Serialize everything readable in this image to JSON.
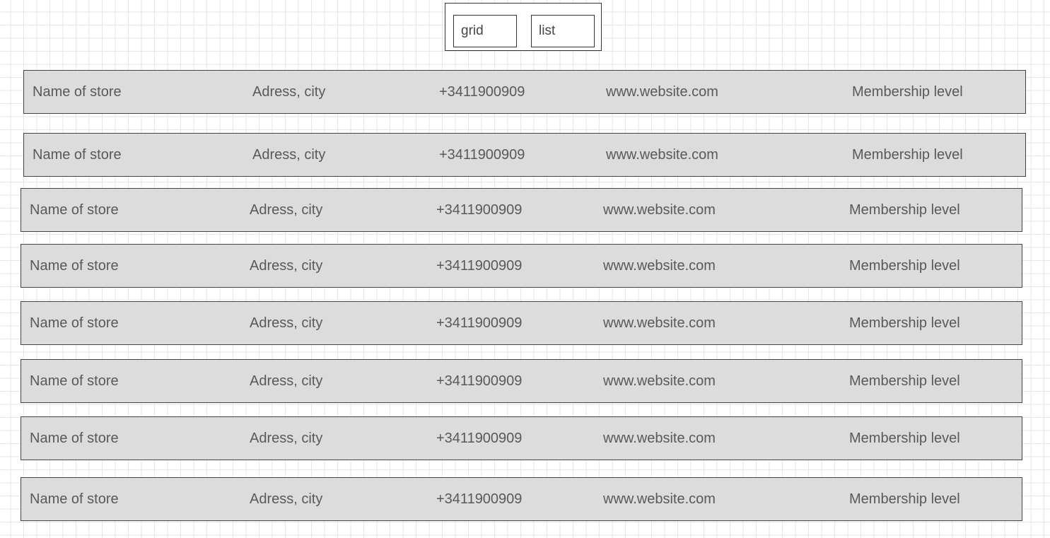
{
  "view_toggle": {
    "grid_label": "grid",
    "list_label": "list"
  },
  "stores": [
    {
      "name": "Name of store",
      "address": "Adress, city",
      "phone": "+3411900909",
      "website": "www.website.com",
      "membership": "Membership level"
    },
    {
      "name": "Name of store",
      "address": "Adress, city",
      "phone": "+3411900909",
      "website": "www.website.com",
      "membership": "Membership level"
    },
    {
      "name": "Name of store",
      "address": "Adress, city",
      "phone": "+3411900909",
      "website": "www.website.com",
      "membership": "Membership level"
    },
    {
      "name": "Name of store",
      "address": "Adress, city",
      "phone": "+3411900909",
      "website": "www.website.com",
      "membership": "Membership level"
    },
    {
      "name": "Name of store",
      "address": "Adress, city",
      "phone": "+3411900909",
      "website": "www.website.com",
      "membership": "Membership level"
    },
    {
      "name": "Name of store",
      "address": "Adress, city",
      "phone": "+3411900909",
      "website": "www.website.com",
      "membership": "Membership level"
    },
    {
      "name": "Name of store",
      "address": "Adress, city",
      "phone": "+3411900909",
      "website": "www.website.com",
      "membership": "Membership level"
    },
    {
      "name": "Name of store",
      "address": "Adress, city",
      "phone": "+3411900909",
      "website": "www.website.com",
      "membership": "Membership level"
    }
  ],
  "colors": {
    "row_background": "#dcdcdc",
    "row_border": "#444444",
    "text": "#595959",
    "grid_lines": "#e6e6e6"
  }
}
